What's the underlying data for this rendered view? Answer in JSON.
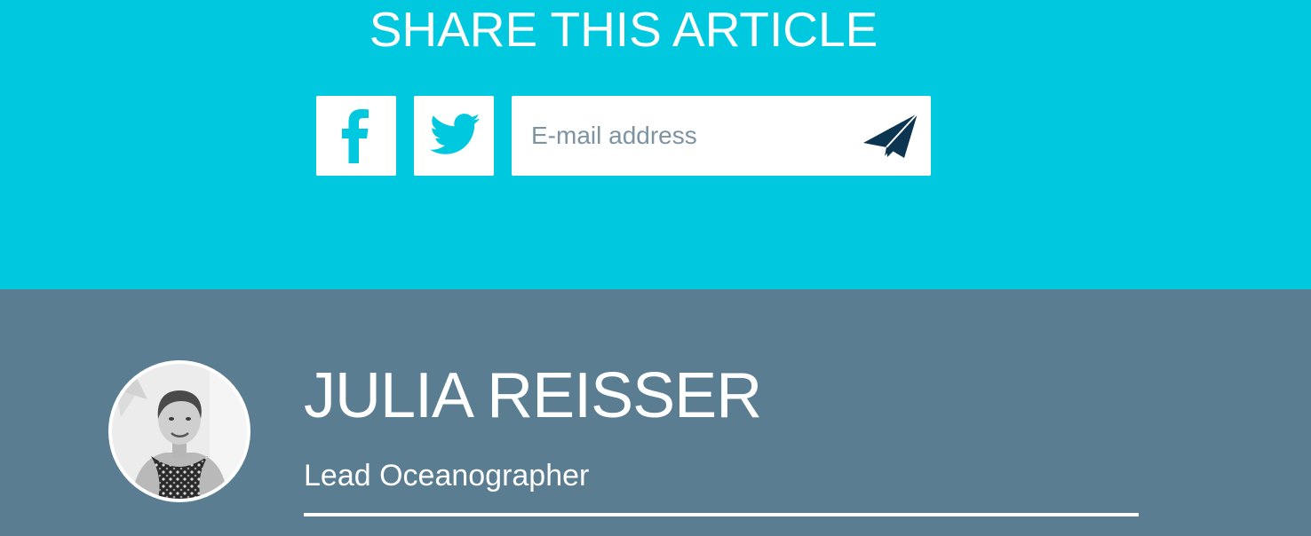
{
  "share": {
    "title": "SHARE THIS ARTICLE",
    "facebook_icon": "facebook-icon",
    "twitter_icon": "twitter-icon",
    "email_placeholder": "E-mail address",
    "send_icon": "paper-plane-icon"
  },
  "author": {
    "name": "JULIA REISSER",
    "role": "Lead Oceanographer",
    "avatar_icon": "avatar-photo"
  },
  "colors": {
    "share_background": "#00c9df",
    "author_background": "#5a7d91",
    "icon_accent": "#00c9df",
    "send_icon": "#0b3550",
    "text": "#ffffff"
  }
}
